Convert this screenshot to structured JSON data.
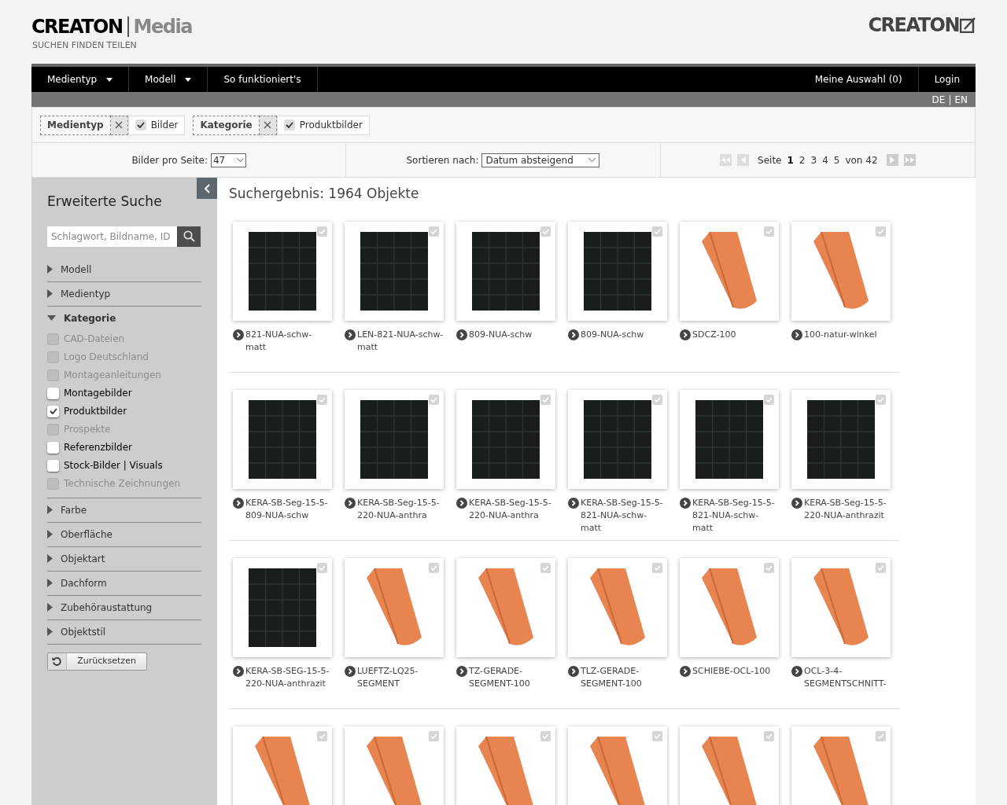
{
  "header": {
    "logo_brand": "CREATON",
    "logo_product": "Media",
    "tagline": "SUCHEN FINDEN TEILEN",
    "right_logo": "CREATON"
  },
  "nav": {
    "left": [
      {
        "label": "Medientyp",
        "dropdown": true
      },
      {
        "label": "Modell",
        "dropdown": true
      },
      {
        "label": "So funktioniert's",
        "dropdown": false
      }
    ],
    "right": [
      "Meine Auswahl (0)",
      "Login"
    ]
  },
  "languages": {
    "items": [
      "DE",
      "EN"
    ],
    "separator": "|"
  },
  "active_filters": [
    {
      "label": "Medientyp",
      "value": "Bilder",
      "checked": true
    },
    {
      "label": "Kategorie",
      "value": "Produktbilder",
      "checked": true
    }
  ],
  "toolbar": {
    "per_page_label": "Bilder pro Seite:",
    "per_page": "47",
    "sort_label": "Sortieren nach:",
    "sort": "Datum absteigend",
    "page_label": "Seite",
    "pages": [
      {
        "label": "1",
        "selected": true
      },
      {
        "label": "2",
        "selected": false
      },
      {
        "label": "3",
        "selected": false
      },
      {
        "label": "4",
        "selected": false
      },
      {
        "label": "5",
        "selected": false
      }
    ],
    "total": "von 42"
  },
  "sidebar": {
    "title": "Erweiterte Suche",
    "search_placeholder": "Schlagwort, Bildname, ID",
    "sections": [
      {
        "label": "Modell",
        "expanded": false
      },
      {
        "label": "Medientyp",
        "expanded": false
      },
      {
        "label": "Kategorie",
        "expanded": true,
        "options": [
          {
            "label": "CAD-Dateien",
            "checked": false,
            "disabled": true
          },
          {
            "label": "Logo Deutschland",
            "checked": false,
            "disabled": true
          },
          {
            "label": "Montageanleitungen",
            "checked": false,
            "disabled": true
          },
          {
            "label": "Montagebilder",
            "checked": false,
            "disabled": false
          },
          {
            "label": "Produktbilder",
            "checked": true,
            "disabled": false
          },
          {
            "label": "Prospekte",
            "checked": false,
            "disabled": true
          },
          {
            "label": "Referenzbilder",
            "checked": false,
            "disabled": false
          },
          {
            "label": "Stock-Bilder | Visuals",
            "checked": false,
            "disabled": false
          },
          {
            "label": "Technische Zeichnungen",
            "checked": false,
            "disabled": true
          }
        ]
      },
      {
        "label": "Farbe",
        "expanded": false
      },
      {
        "label": "Oberfläche",
        "expanded": false
      },
      {
        "label": "Objektart",
        "expanded": false
      },
      {
        "label": "Dachform",
        "expanded": false
      },
      {
        "label": "Zubehöraustattung",
        "expanded": false
      },
      {
        "label": "Objektstil",
        "expanded": false
      }
    ],
    "reset": "Zurücksetzen"
  },
  "results": {
    "title": "Suchergebnis: 1964 Objekte",
    "rows": [
      [
        {
          "name": "821-NUA-schw-matt",
          "kind": "dark",
          "checked": false
        },
        {
          "name": "LEN-821-NUA-schw-matt",
          "kind": "dark",
          "checked": false
        },
        {
          "name": "809-NUA-schw",
          "kind": "dark",
          "checked": false
        },
        {
          "name": "809-NUA-schw",
          "kind": "dark",
          "checked": false
        },
        {
          "name": "SDCZ-100",
          "kind": "terracotta",
          "checked": false
        },
        {
          "name": "100-natur-winkel",
          "kind": "terracotta",
          "checked": false
        }
      ],
      [
        {
          "name": "KERA-SB-Seg-15-5-809-NUA-schw",
          "kind": "dark",
          "checked": false
        },
        {
          "name": "KERA-SB-Seg-15-5-220-NUA-anthra",
          "kind": "dark",
          "checked": false
        },
        {
          "name": "KERA-SB-Seg-15-5-220-NUA-anthra",
          "kind": "dark",
          "checked": false
        },
        {
          "name": "KERA-SB-Seg-15-5-821-NUA-schw-matt",
          "kind": "dark",
          "checked": false
        },
        {
          "name": "KERA-SB-Seg-15-5-821-NUA-schw-matt",
          "kind": "dark",
          "checked": false
        },
        {
          "name": "KERA-SB-Seg-15-5-220-NUA-anthrazit",
          "kind": "dark",
          "checked": false
        }
      ],
      [
        {
          "name": "KERA-SB-SEG-15-5-220-NUA-anthrazit",
          "kind": "dark",
          "checked": false
        },
        {
          "name": "LUEFTZ-LQ25-SEGMENT",
          "kind": "terracotta",
          "checked": false
        },
        {
          "name": "TZ-GERADE-SEGMENT-100",
          "kind": "terracotta",
          "checked": false
        },
        {
          "name": "TLZ-GERADE-SEGMENT-100",
          "kind": "terracotta",
          "checked": false
        },
        {
          "name": "SCHIEBE-OCL-100",
          "kind": "terracotta",
          "checked": false
        },
        {
          "name": "OCL-3-4-SEGMENTSCHNITT-",
          "kind": "terracotta",
          "checked": false
        }
      ],
      [
        {
          "kind": "terracotta",
          "checked": false
        },
        {
          "kind": "terracotta",
          "checked": false
        },
        {
          "kind": "terracotta",
          "checked": false
        },
        {
          "kind": "terracotta",
          "checked": false
        },
        {
          "kind": "terracotta",
          "checked": false
        },
        {
          "kind": "terracotta",
          "checked": false
        }
      ]
    ]
  }
}
